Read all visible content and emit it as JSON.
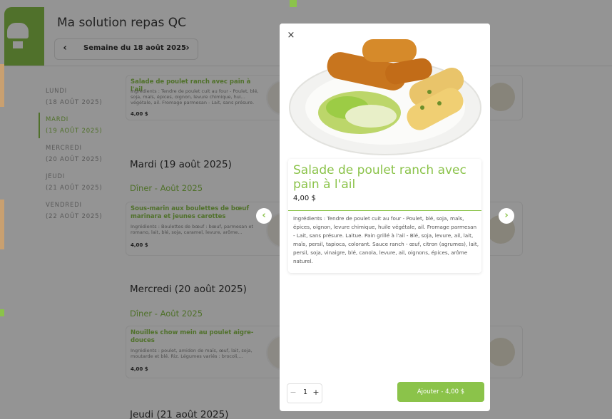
{
  "header": {
    "title": "Ma solution repas QC",
    "week_label": "Semaine du 18 août 2025",
    "prev_icon": "‹",
    "next_icon": "›"
  },
  "sidebar": {
    "days": [
      {
        "line1": "LUNDI",
        "line2": "(18 AOÛT 2025)",
        "active": false
      },
      {
        "line1": "MARDI",
        "line2": "(19 AOÛT 2025)",
        "active": true
      },
      {
        "line1": "MERCREDI",
        "line2": "(20 AOÛT 2025)",
        "active": false
      },
      {
        "line1": "JEUDI",
        "line2": "(21 AOÛT 2025)",
        "active": false
      },
      {
        "line1": "VENDREDI",
        "line2": "(22 AOÛT 2025)",
        "active": false
      }
    ]
  },
  "menu": {
    "card_monday": {
      "title": "Salade de poulet ranch avec pain à l'ail",
      "ingredients": "Ingrédients : Tendre de poulet cuit au four - Poulet, blé, soja, maïs, épices, oignon, levure chimique, hui... végétale, ail. Fromage parmesan - Lait, sans présure.",
      "price": "4,00 $"
    },
    "tuesday_heading": "Mardi (19 août 2025)",
    "tuesday_meal": "Dîner - Août 2025",
    "card_tuesday": {
      "title": "Sous-marin aux boulettes de bœuf marinara et jeunes carottes",
      "ingredients": "Ingrédients : Boulettes de bœuf : bœuf, parmesan et romano, lait, blé, soja, caramel, levure, arôme...",
      "price": "4,00 $"
    },
    "wednesday_heading": "Mercredi (20 août 2025)",
    "wednesday_meal": "Dîner - Août 2025",
    "card_wednesday": {
      "title": "Nouilles chow mein au poulet aigre-douces",
      "ingredients": "Ingrédients : poulet, amidon de maïs, œuf, lait, soja, moutarde et blé. Riz. Légumes variés : brocoli,...",
      "price": "4,00 $"
    },
    "thursday_heading": "Jeudi (21 août 2025)"
  },
  "modal": {
    "close_icon": "×",
    "title": "Salade de poulet ranch avec pain à l'ail",
    "price": "4,00 $",
    "description": "Ingrédients : Tendre de poulet cuit au four - Poulet, blé, soja, maïs, épices, oignon, levure chimique, huile végétale, ail. Fromage parmesan - Lait, sans présure. Laitue. Pain grillé à l'ail - Blé, soja, levure, ail, lait, maïs, persil, tapioca, colorant. Sauce ranch - œuf, citron (agrumes), lait, persil, soja, vinaigre, blé, canola, levure, ail, oignons, épices, arôme naturel.",
    "qty_minus": "−",
    "quantity": "1",
    "qty_plus": "+",
    "add_button": "Ajouter - 4,00 $",
    "prev_icon": "‹",
    "next_icon": "›"
  },
  "colors": {
    "accent": "#8bc34a"
  }
}
